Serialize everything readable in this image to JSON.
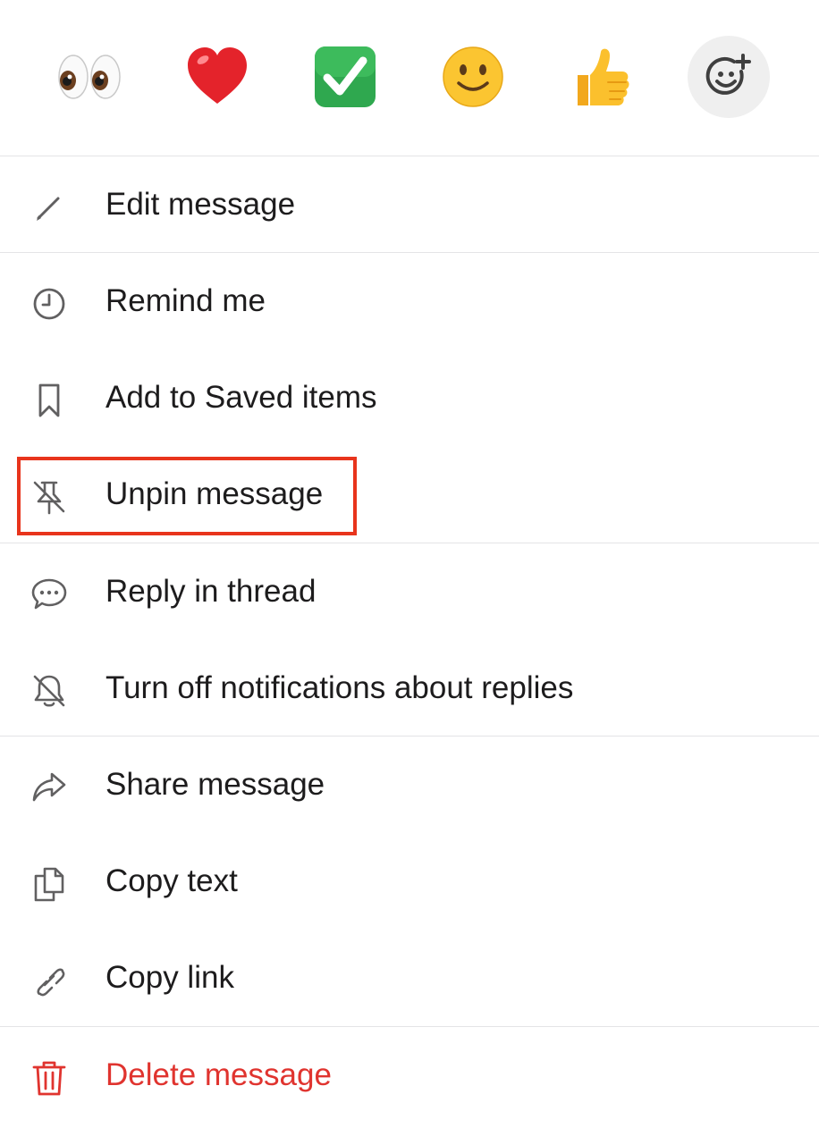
{
  "reactions": [
    {
      "name": "eyes",
      "icon": "eyes-emoji"
    },
    {
      "name": "heart",
      "icon": "heart-emoji"
    },
    {
      "name": "white_check_mark",
      "icon": "check-mark-emoji"
    },
    {
      "name": "slightly_smiling_face",
      "icon": "smiling-face-emoji"
    },
    {
      "name": "thumbs_up",
      "icon": "thumbs-up-emoji"
    },
    {
      "name": "add_reaction",
      "icon": "add-reaction-icon"
    }
  ],
  "menu": {
    "edit": "Edit message",
    "remind": "Remind me",
    "save": "Add to Saved items",
    "unpin": "Unpin message",
    "reply": "Reply in thread",
    "notifications": "Turn off notifications about replies",
    "share": "Share message",
    "copy_text": "Copy text",
    "copy_link": "Copy link",
    "delete": "Delete message"
  },
  "colors": {
    "text": "#1d1c1d",
    "icon": "#616061",
    "danger": "#e0342f",
    "highlight": "#e8341c",
    "divider": "#e4e4e6"
  }
}
